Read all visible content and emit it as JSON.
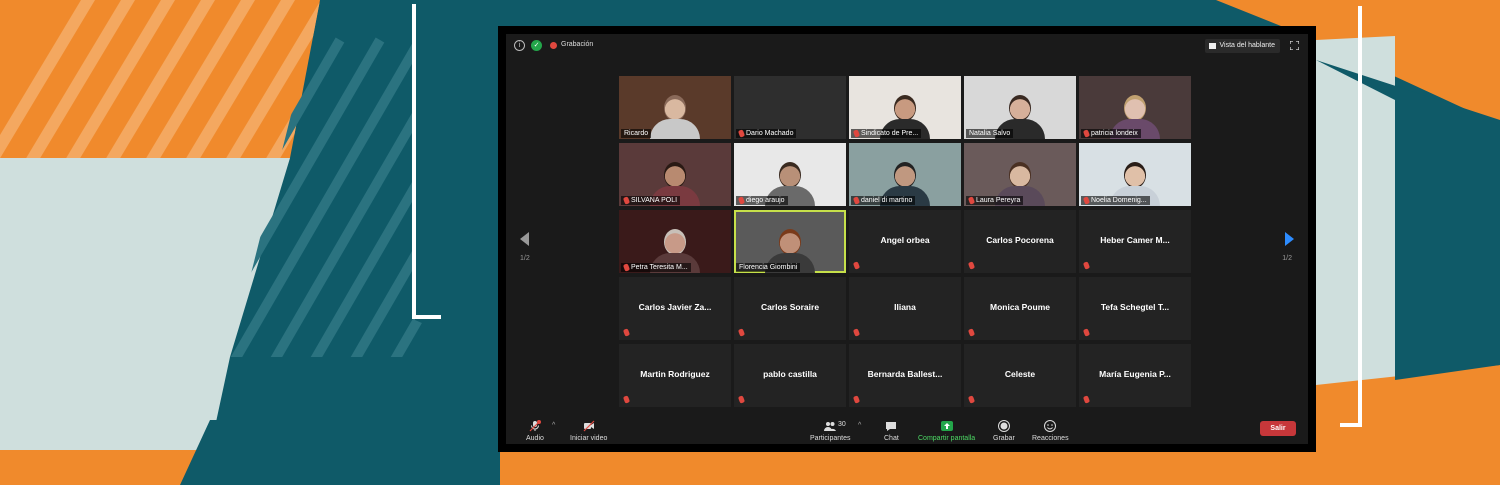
{
  "colors": {
    "orange": "#f08a2c",
    "teal": "#0f5a68",
    "light": "#cfdfdd",
    "accent_green": "#23a64a",
    "active_speaker": "#c6e04a",
    "leave_red": "#c7373a",
    "next_arrow": "#2d8cff"
  },
  "topbar": {
    "recording_label": "Grabación",
    "view_label": "Vista del hablante",
    "icons": [
      "info-icon",
      "shield-check-icon",
      "recording-dot-icon",
      "grid-icon",
      "fullscreen-icon"
    ]
  },
  "pagination": {
    "left": "1/2",
    "right": "1/2"
  },
  "participants": [
    {
      "name": "Ricardo",
      "video": true,
      "muted": false
    },
    {
      "name": "Dario Machado",
      "video": true,
      "muted": true
    },
    {
      "name": "Sindicato de Pre...",
      "video": true,
      "muted": true
    },
    {
      "name": "Natalia Salvo",
      "video": true,
      "muted": false
    },
    {
      "name": "patricia londeix",
      "video": true,
      "muted": true
    },
    {
      "name": "SILVANA POLI",
      "video": true,
      "muted": true
    },
    {
      "name": "diego araujo",
      "video": true,
      "muted": true
    },
    {
      "name": "daniel di martino",
      "video": true,
      "muted": true
    },
    {
      "name": "Laura Pereyra",
      "video": true,
      "muted": true
    },
    {
      "name": "Noelia Domenig...",
      "video": true,
      "muted": true
    },
    {
      "name": "Petra Teresita M...",
      "video": true,
      "muted": true
    },
    {
      "name": "Florencia Giombini",
      "video": true,
      "muted": false,
      "active": true
    },
    {
      "name": "Angel orbea",
      "video": false,
      "muted": true
    },
    {
      "name": "Carlos Pocorena",
      "video": false,
      "muted": true
    },
    {
      "name": "Heber Camer M...",
      "video": false,
      "muted": true
    },
    {
      "name": "Carlos Javier Za...",
      "video": false,
      "muted": true
    },
    {
      "name": "Carlos Soraire",
      "video": false,
      "muted": true
    },
    {
      "name": "Iliana",
      "video": false,
      "muted": true
    },
    {
      "name": "Monica Poume",
      "video": false,
      "muted": true
    },
    {
      "name": "Tefa Schegtel T...",
      "video": false,
      "muted": true
    },
    {
      "name": "Martin Rodriguez",
      "video": false,
      "muted": true
    },
    {
      "name": "pablo castilla",
      "video": false,
      "muted": true
    },
    {
      "name": "Bernarda Ballest...",
      "video": false,
      "muted": true
    },
    {
      "name": "Celeste",
      "video": false,
      "muted": true
    },
    {
      "name": "María Eugenia P...",
      "video": false,
      "muted": true
    }
  ],
  "toolbar": {
    "audio_label": "Audio",
    "video_label": "Iniciar video",
    "participants_label": "Participantes",
    "participants_count": "30",
    "chat_label": "Chat",
    "share_label": "Compartir pantalla",
    "record_label": "Grabar",
    "reactions_label": "Reacciones",
    "leave_label": "Salir"
  }
}
